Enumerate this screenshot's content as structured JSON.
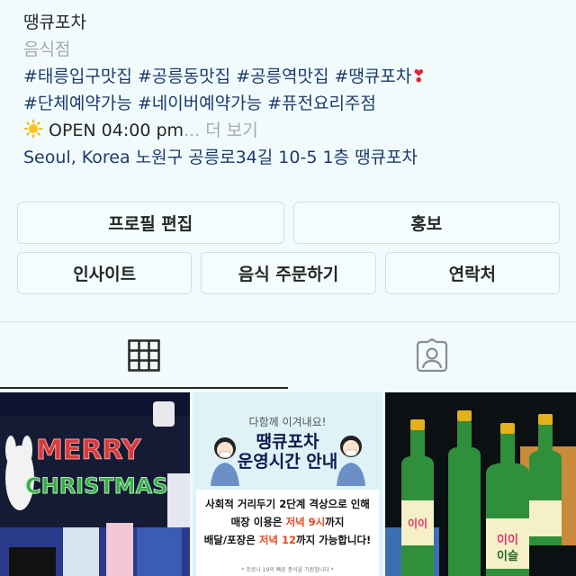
{
  "profile": {
    "name": "땡큐포차",
    "category": "음식점",
    "tags_line1": [
      "#태릉입구맛집",
      "#공릉동맛집",
      "#공릉역맛집",
      "#땡큐포차"
    ],
    "heart": "❣",
    "tags_line2": [
      "#단체예약가능",
      "#네이버예약가능",
      "#퓨전요리주점"
    ],
    "open_text": "OPEN 04:00 pm",
    "more_text": "... 더 보기",
    "location": "Seoul, Korea 노원구 공릉로34길 10-5 1층 땡큐포차"
  },
  "buttons": {
    "edit_profile": "프로필 편집",
    "promote": "홍보",
    "insights": "인사이트",
    "order_food": "음식 주문하기",
    "contact": "연락처"
  },
  "tabs": [
    {
      "name": "grid",
      "icon": "grid-icon",
      "active": true
    },
    {
      "name": "tagged",
      "icon": "tagged-person-icon",
      "active": false
    }
  ],
  "posts": {
    "post1": {
      "sign_text_1": "MERRY",
      "sign_text_2": "CHRISTMAS"
    },
    "post2": {
      "header": "다함께 이겨내요!",
      "title_1": "땡큐포차",
      "title_2": "운영시간 안내",
      "line1": "사회적 거리두기 2단계 격상으로 인해",
      "line2_a": "매장 이용은 ",
      "line2_hl": "저녁 9시",
      "line2_b": "까지",
      "line3_a": "배달/포장은 ",
      "line3_hl": "저녁 12",
      "line3_b": "까지 가능합니다!",
      "footer": "* 코로나 19의 빠른 종식을 기원합니다 *"
    },
    "post3": {
      "label_1": "이이",
      "label_2": "이슬"
    }
  },
  "colors": {
    "background": "#f1fbfc",
    "link": "#1d3a6b",
    "muted": "#a8a8a8",
    "highlight": "#e24a1f"
  }
}
